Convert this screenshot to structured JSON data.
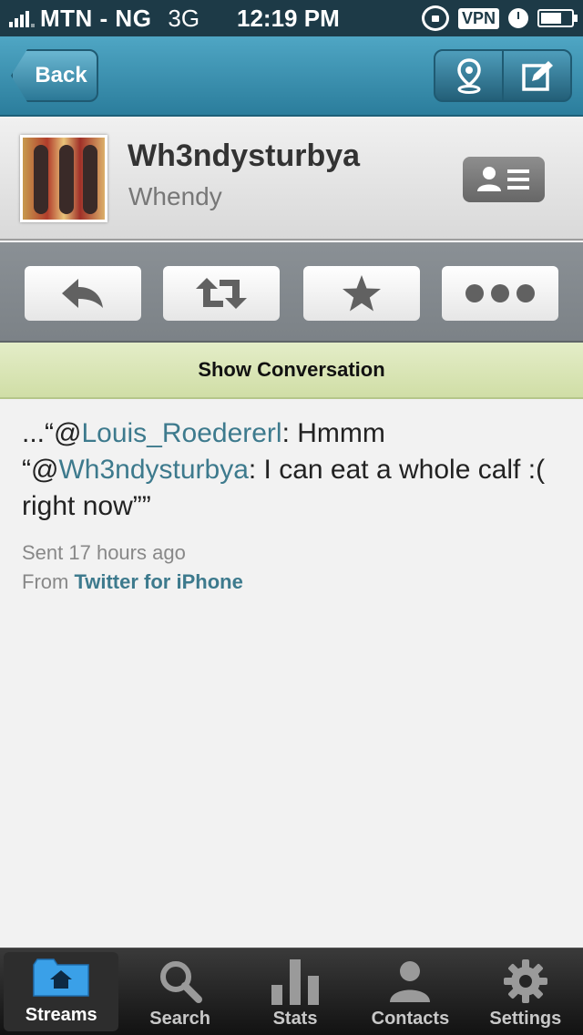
{
  "status_bar": {
    "carrier": "MTN - NG",
    "network": "3G",
    "time": "12:19 PM",
    "vpn": "VPN",
    "icons": [
      "signal-icon",
      "rotation-lock-icon",
      "vpn-icon",
      "alarm-clock-icon",
      "battery-icon"
    ]
  },
  "nav": {
    "back_label": "Back",
    "right_buttons": [
      "location-pin-icon",
      "compose-icon"
    ]
  },
  "profile": {
    "username": "Wh3ndysturbya",
    "display_name": "Whendy"
  },
  "actions": [
    "reply-icon",
    "retweet-icon",
    "favorite-star-icon",
    "more-icon"
  ],
  "show_conversation_label": "Show Conversation",
  "tweet": {
    "prefix": "...“@",
    "mention1": "Louis_Roedererl",
    "text1": ": Hmmm “@",
    "mention2": "Wh3ndysturbya",
    "text2": ": I can eat a whole calf :( right now””",
    "sent": "Sent 17 hours ago",
    "from_prefix": "From ",
    "client": "Twitter for iPhone"
  },
  "tabs": [
    {
      "label": "Streams",
      "icon": "streams-folder-icon",
      "active": true
    },
    {
      "label": "Search",
      "icon": "search-icon",
      "active": false
    },
    {
      "label": "Stats",
      "icon": "stats-icon",
      "active": false
    },
    {
      "label": "Contacts",
      "icon": "contacts-icon",
      "active": false
    },
    {
      "label": "Settings",
      "icon": "settings-gear-icon",
      "active": false
    }
  ],
  "colors": {
    "status_bar": "#1d3a47",
    "nav_bar": "#3a8fb0",
    "link": "#3d7a8d",
    "show_conversation_bg": "#dce7b9"
  }
}
